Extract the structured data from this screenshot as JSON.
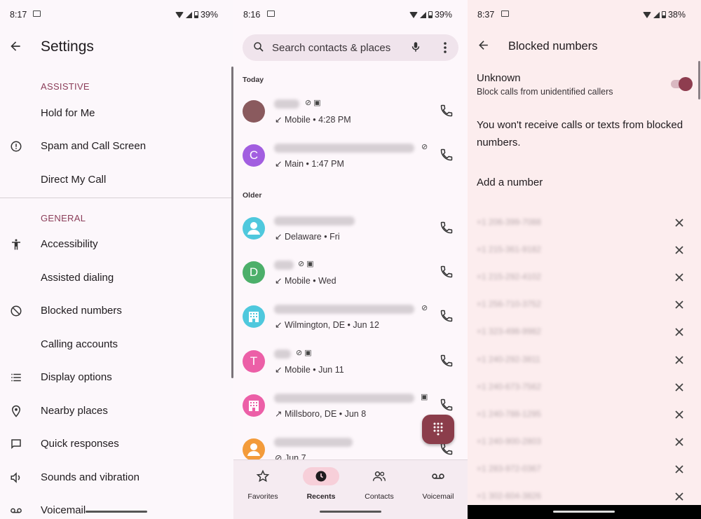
{
  "colors": {
    "accent": "#8b3d59",
    "fab": "#8b3d4b",
    "toggle_on": "#8e3d4f"
  },
  "settings_screen": {
    "status": {
      "time": "8:17",
      "battery": "39%"
    },
    "title": "Settings",
    "sections": [
      {
        "header": "ASSISTIVE",
        "items": [
          {
            "label": "Hold for Me",
            "icon": ""
          },
          {
            "label": "Spam and Call Screen",
            "icon": "alert-circle-icon"
          },
          {
            "label": "Direct My Call",
            "icon": ""
          }
        ]
      },
      {
        "header": "GENERAL",
        "items": [
          {
            "label": "Accessibility",
            "icon": "accessibility-icon"
          },
          {
            "label": "Assisted dialing",
            "icon": ""
          },
          {
            "label": "Blocked numbers",
            "icon": "block-icon"
          },
          {
            "label": "Calling accounts",
            "icon": ""
          },
          {
            "label": "Display options",
            "icon": "list-icon"
          },
          {
            "label": "Nearby places",
            "icon": "location-pin-icon"
          },
          {
            "label": "Quick responses",
            "icon": "message-icon"
          },
          {
            "label": "Sounds and vibration",
            "icon": "volume-icon"
          },
          {
            "label": "Voicemail",
            "icon": "voicemail-icon"
          }
        ]
      }
    ]
  },
  "recents_screen": {
    "status": {
      "time": "8:16",
      "battery": "39%"
    },
    "search": {
      "placeholder": "Search contacts & places"
    },
    "groups": [
      {
        "label": "Today",
        "calls": [
          {
            "avatar": "",
            "avatar_color": "#8a5a5e",
            "detail": "Mobile • 4:28 PM",
            "direction": "incoming"
          },
          {
            "avatar": "C",
            "avatar_color": "#a25ee0",
            "detail": "Main • 1:47 PM",
            "direction": "incoming"
          }
        ]
      },
      {
        "label": "Older",
        "calls": [
          {
            "avatar": "",
            "avatar_color": "#4fc8dd",
            "detail": "Delaware • Fri",
            "direction": "incoming"
          },
          {
            "avatar": "D",
            "avatar_color": "#4caf6a",
            "detail": "Mobile • Wed",
            "direction": "incoming"
          },
          {
            "avatar": "",
            "avatar_color": "#4fc8dd",
            "detail": "Wilmington, DE • Jun 12",
            "direction": "incoming"
          },
          {
            "avatar": "T",
            "avatar_color": "#ec5fa7",
            "detail": "Mobile • Jun 11",
            "direction": "incoming"
          },
          {
            "avatar": "",
            "avatar_color": "#ec5fa7",
            "detail": "Millsboro, DE • Jun 8",
            "direction": "outgoing"
          },
          {
            "avatar": "",
            "avatar_color": "#f39b3a",
            "detail": "Jun 7",
            "direction": "missed"
          }
        ]
      }
    ],
    "nav": [
      {
        "label": "Favorites",
        "icon": "star-icon",
        "active": false
      },
      {
        "label": "Recents",
        "icon": "clock-icon",
        "active": true
      },
      {
        "label": "Contacts",
        "icon": "people-icon",
        "active": false
      },
      {
        "label": "Voicemail",
        "icon": "voicemail-icon",
        "active": false
      }
    ]
  },
  "blocked_screen": {
    "status": {
      "time": "8:37",
      "battery": "38%"
    },
    "title": "Blocked numbers",
    "unknown": {
      "title": "Unknown",
      "subtitle": "Block calls from unidentified callers",
      "enabled": true
    },
    "info": "You won't receive calls or texts from blocked numbers.",
    "add_number": "Add a number",
    "numbers": [
      "+1 206-399-7088",
      "+1 215-361-9182",
      "+1 215-292-4102",
      "+1 256-710-3752",
      "+1 323-498-9982",
      "+1 240-292-3811",
      "+1 240-673-7562",
      "+1 240-788-1295",
      "+1 240-900-2803",
      "+1 283-972-0367",
      "+1 302-604-3826"
    ]
  }
}
